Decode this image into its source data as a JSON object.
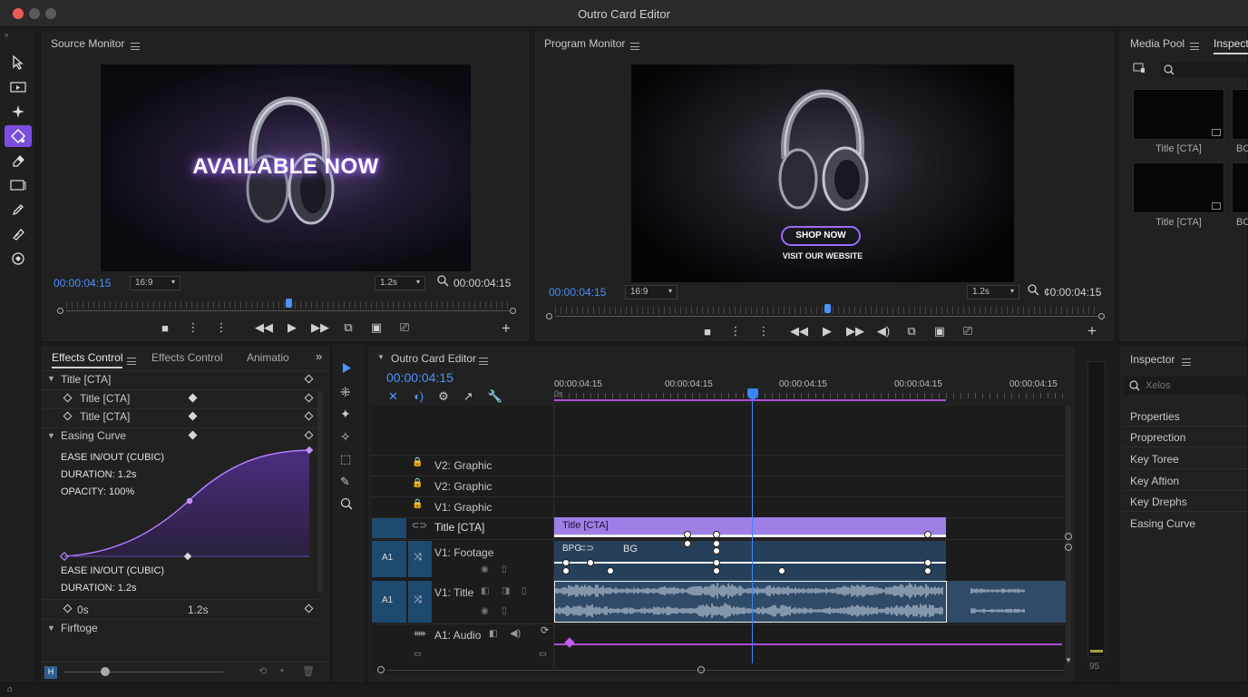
{
  "window": {
    "title": "Outro Card Editor"
  },
  "colors": {
    "accent": "#9b6cf5",
    "timecode": "#4d90fe",
    "clip_title": "#9f7ee6",
    "clip_footage": "#27405a",
    "playhead": "#3a86ff",
    "audio_wave": "#a9b6c9"
  },
  "tools": [
    "selection-icon",
    "track-select-icon",
    "sparkle-icon",
    "pen-keyframe-icon",
    "eraser-icon",
    "slip-icon",
    "pencil-icon",
    "razor-icon",
    "hand-icon"
  ],
  "source": {
    "title": "Source Monitor",
    "overlay_text": "AVAILABLE NOW",
    "timecode": "00:00:04:15",
    "aspect": "16:9",
    "zoom": "1.2s",
    "duration": "00:00:04:15",
    "playhead_fraction": 0.5
  },
  "program": {
    "title": "Program Monitor",
    "cta_button": "SHOP NOW",
    "cta_sub": "VISIT OUR WEBSITE",
    "timecode": "00:00:04:15",
    "aspect": "16:9",
    "zoom": "1.2s",
    "duration": "¢0:00:04:15",
    "playhead_fraction": 0.5
  },
  "media_pool": {
    "tab1": "Media Pool",
    "tab2": "Inspect",
    "items": [
      {
        "label": "Title [CTA]"
      },
      {
        "label": "BC"
      },
      {
        "label": "Title [CTA]"
      },
      {
        "label": "BC"
      }
    ]
  },
  "effects": {
    "tabs": [
      "Effects Control",
      "Effects Control",
      "Animatio"
    ],
    "rows": [
      {
        "label": "Title [CTA]"
      },
      {
        "label": "Title [CTA]"
      },
      {
        "label": "Title [CTA]"
      },
      {
        "label": "Easing Curve"
      }
    ],
    "curve_info": [
      "EASE IN/OUT (CUBIC)",
      "DURATION: 1.2s",
      "OPACITY: 100%"
    ],
    "curve_info2": [
      "EASE IN/OUT (CUBIC)",
      "DURATION: 1.2s"
    ],
    "range_start": "0s",
    "range_end": "1.2s",
    "section": "Firftoge"
  },
  "timeline": {
    "title": "Outro Card Editor",
    "timecode": "00:00:04:15",
    "ruler": [
      "00:00:04:15",
      "00:00:04:15",
      "00:00:04:15",
      "00:00:04:15",
      "00:00:04:15"
    ],
    "ruler_sub": "0s",
    "tracks": [
      {
        "label": "V2: Graphic"
      },
      {
        "label": "V2: Graphic"
      },
      {
        "label": "V1: Graphic"
      },
      {
        "label": "Title [CTA]"
      },
      {
        "label": "V1: Footage"
      },
      {
        "label": "V1: Title"
      },
      {
        "label": "A1: Audio"
      }
    ],
    "clip_title": "Title [CTA]",
    "clip_footage_a": "BPG",
    "clip_footage_b": "BG",
    "a1_label": "A1"
  },
  "inspector": {
    "title": "Inspector",
    "search_placeholder": "Xelos",
    "rows": [
      "Properties",
      "Proprection",
      "Key Toree",
      "Key Aftion",
      "Key Drephs",
      "Easing Curve"
    ]
  },
  "meter": {
    "value": "95"
  }
}
